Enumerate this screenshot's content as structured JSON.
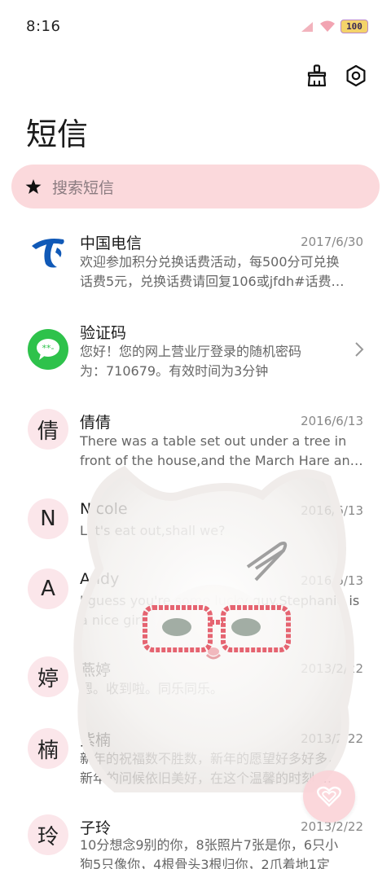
{
  "status": {
    "time": "8:16",
    "battery": "100"
  },
  "title": "短信",
  "search": {
    "placeholder": "搜索短信"
  },
  "conversations": [
    {
      "name": "中国电信",
      "date": "2017/6/30",
      "preview": [
        "欢迎参加积分兑换话费活动，每500分可兑换",
        "话费5元，兑换话费请回复106或jfdh#话费…"
      ]
    },
    {
      "name": "验证码",
      "date": "",
      "preview": [
        "您好！您的网上营业厅登录的随机密码",
        "为：710679。有效时间为3分钟"
      ]
    },
    {
      "name": "倩倩",
      "avatar": "倩",
      "date": "2016/6/13",
      "preview": [
        "There was a table set out under a tree in",
        "front of the house,and the March Hare an…"
      ]
    },
    {
      "name": "Nicole",
      "avatar": "N",
      "date": "2016/6/13",
      "preview": [
        "Let's eat out,shall we?"
      ]
    },
    {
      "name": "Andy",
      "avatar": "A",
      "date": "2016/6/13",
      "preview": [
        "I guess you're some lucky guy.Stephanie is",
        "a nice girl."
      ]
    },
    {
      "name": "燕婷",
      "avatar": "婷",
      "date": "2013/2/22",
      "preview": [
        "嗯。收到啦。同乐同乐。"
      ]
    },
    {
      "name": "紫楠",
      "avatar": "楠",
      "date": "2013/2/22",
      "preview": [
        "新年的祝福数不胜数，新年的愿望好多好多，",
        "新年的问候依旧美好，在这个温馨的时刻 …"
      ]
    },
    {
      "name": "子玲",
      "avatar": "玲",
      "date": "2013/2/22",
      "preview": [
        "10分想念9别的你，8张照片7张是你，6只小",
        "狗5只像你，4根骨头3根归你，2爪着地1定"
      ]
    }
  ]
}
